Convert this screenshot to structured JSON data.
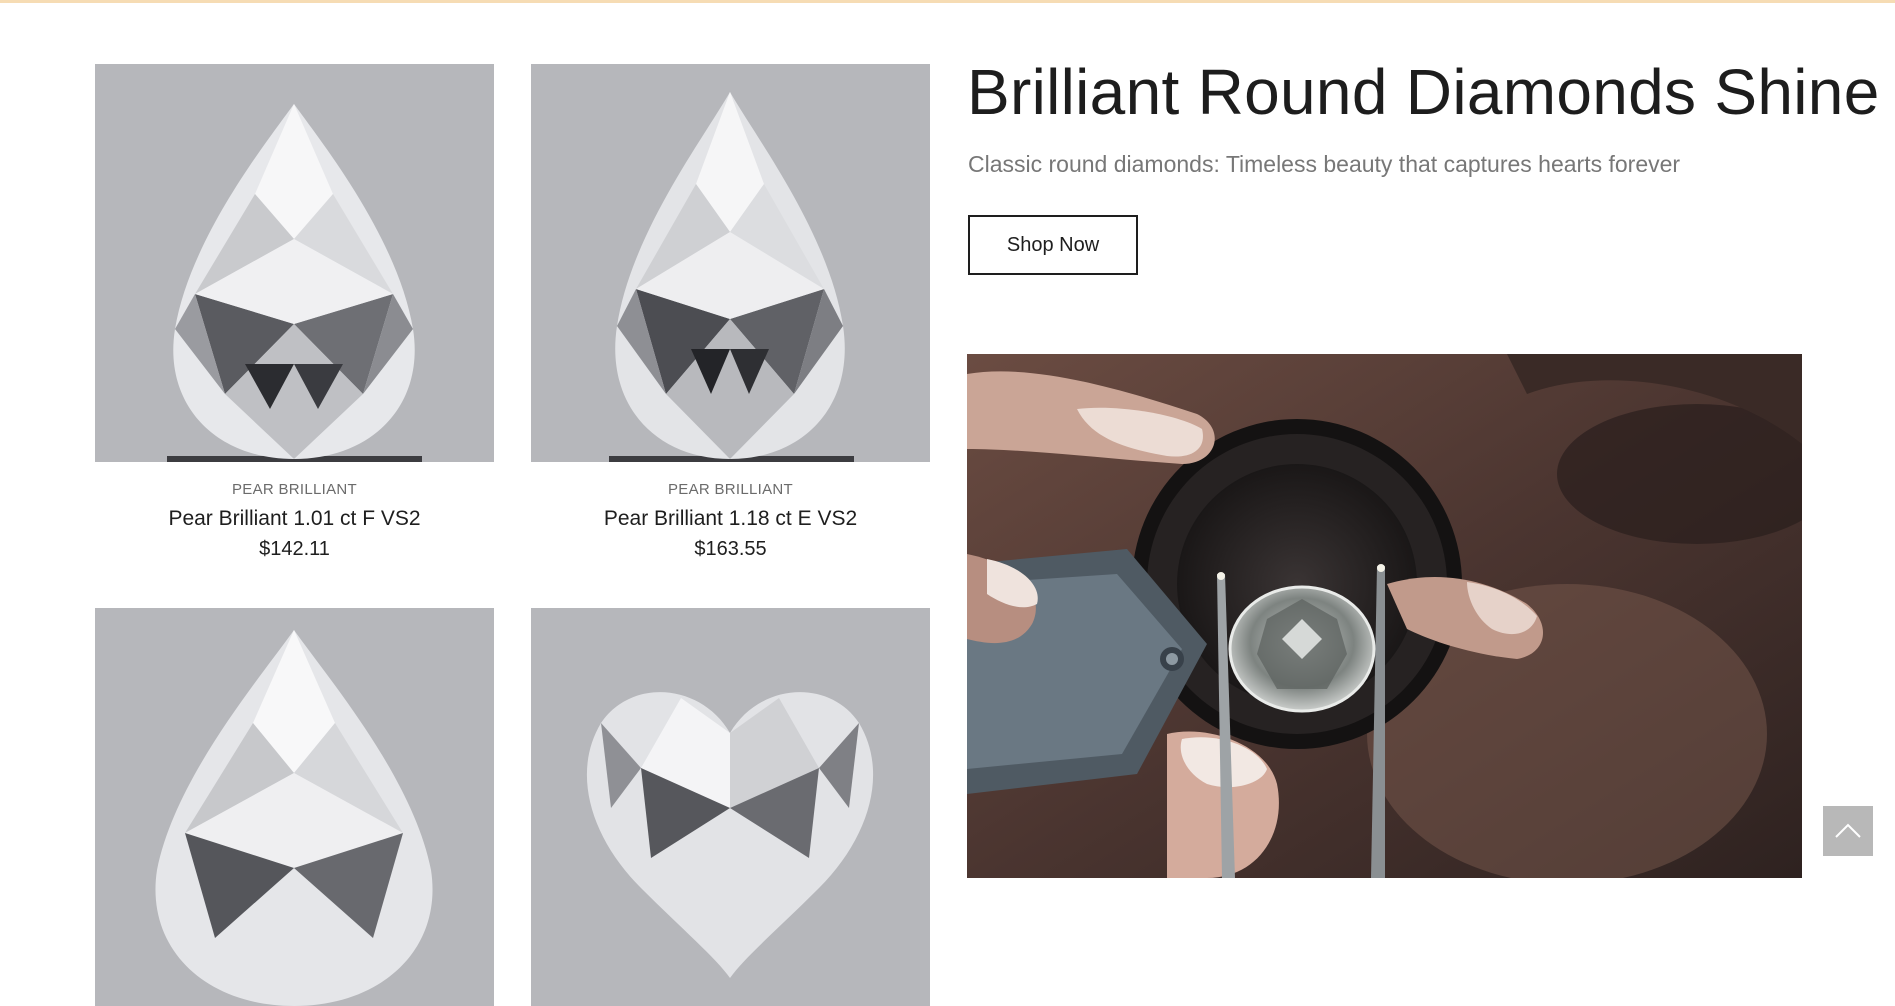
{
  "hero": {
    "title": "Brilliant Round Diamonds Shine",
    "subtitle": "Classic round diamonds: Timeless beauty that captures hearts forever",
    "button_label": "Shop Now"
  },
  "products": [
    {
      "category": "PEAR BRILLIANT",
      "title": "Pear Brilliant 1.01 ct F VS2",
      "price": "$142.11",
      "image_icon": "pear-diamond"
    },
    {
      "category": "PEAR BRILLIANT",
      "title": "Pear Brilliant 1.18 ct E VS2",
      "price": "$163.55",
      "image_icon": "pear-diamond"
    },
    {
      "image_icon": "pear-diamond"
    },
    {
      "image_icon": "heart-diamond"
    }
  ],
  "hero_image": {
    "image_icon": "diamond-inspection-loupe"
  },
  "back_to_top": {
    "icon": "chevron-up-icon"
  },
  "colors": {
    "top_strip": "#f6dcb4",
    "image_background": "#b6b7bb",
    "text_primary": "#1e1e1e",
    "text_muted": "#777777",
    "back_to_top_bg": "#b8b8b8"
  }
}
